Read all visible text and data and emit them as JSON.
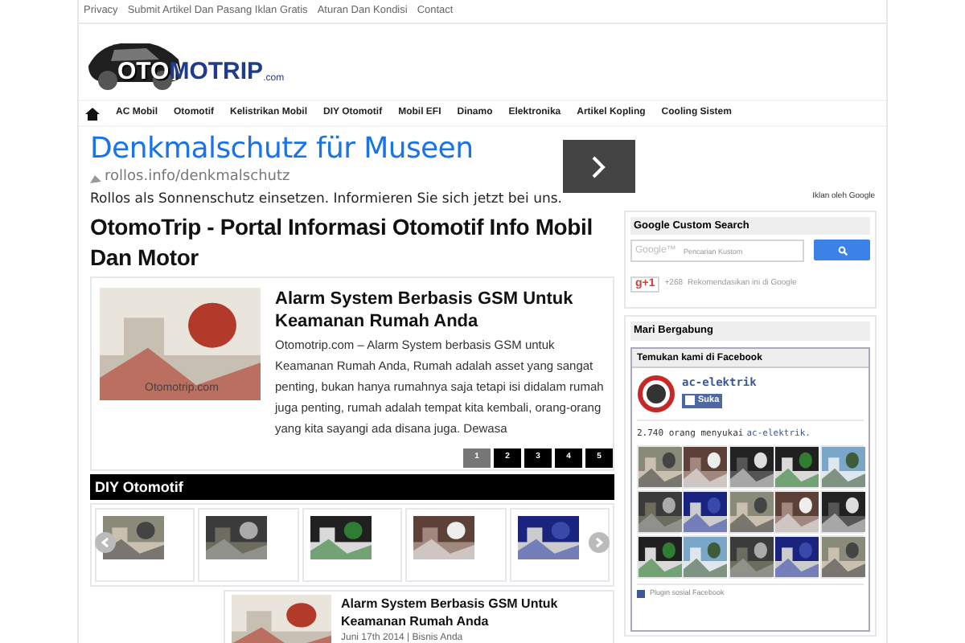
{
  "top_links": [
    "Privacy",
    "Submit Artikel Dan Pasang Iklan Gratis",
    "Aturan Dan Kondisi",
    "Contact"
  ],
  "logo": {
    "part_1": "OTO",
    "part_2": "MOTRIP",
    "suffix": ".com"
  },
  "nav": [
    "AC Mobil",
    "Otomotif",
    "Kelistrikan Mobil",
    "DIY Otomotif",
    "Mobil EFI",
    "Dinamo",
    "Elektronika",
    "Artikel Kopling",
    "Cooling Sistem"
  ],
  "ad": {
    "title": "Denkmalschutz für Museen",
    "url": "rollos.info/denkmalschutz",
    "description": "Rollos als Sonnenschutz einsetzen. Informieren Sie sich jetzt bei uns.",
    "attribution": "Iklan oleh Google"
  },
  "page_title": "OtomoTrip - Portal Informasi Otomotif Info Mobil Dan Motor",
  "featured": {
    "title": "Alarm System Berbasis GSM Untuk Keamanan Rumah Anda",
    "excerpt": "Otomotrip.com – Alarm System berbasis GSM untuk Keamanan Rumah Anda, Rumah adalah asset yang sangat penting, bukan hanya rumahnya saja tetapi isi didalam rumah juga penting, rumah adalah tempat kita kembali, orang-orang yang kita sayangi ada disana juga. Dewasa",
    "watermark": "Otomotrip.com",
    "pages": [
      {
        "label": "1",
        "selected": true
      },
      {
        "label": "2",
        "selected": false
      },
      {
        "label": "3",
        "selected": false
      },
      {
        "label": "4",
        "selected": false
      },
      {
        "label": "5",
        "selected": false
      }
    ]
  },
  "section_title": "DIY Otomotif",
  "related": {
    "title": "Alarm System Berbasis GSM Untuk Keamanan Rumah Anda",
    "meta": "Juni 17th 2014 | Bisnis Anda"
  },
  "search_widget": {
    "title": "Google Custom Search",
    "brand": "Google™",
    "placeholder": "Pencarian Kustom",
    "plus_label": "g+1",
    "plus_count": "+268",
    "plus_text": "Rekomendasikan ini di Google"
  },
  "join_widget": {
    "title": "Mari Bergabung"
  },
  "facebook": {
    "title": "Temukan kami di Facebook",
    "page": "ac-elektrik",
    "like": "Suka",
    "fans_text": "2.740 orang menyukai",
    "fans_link": "ac-elektrik.",
    "footer": "Plugin sosial Facebook"
  }
}
